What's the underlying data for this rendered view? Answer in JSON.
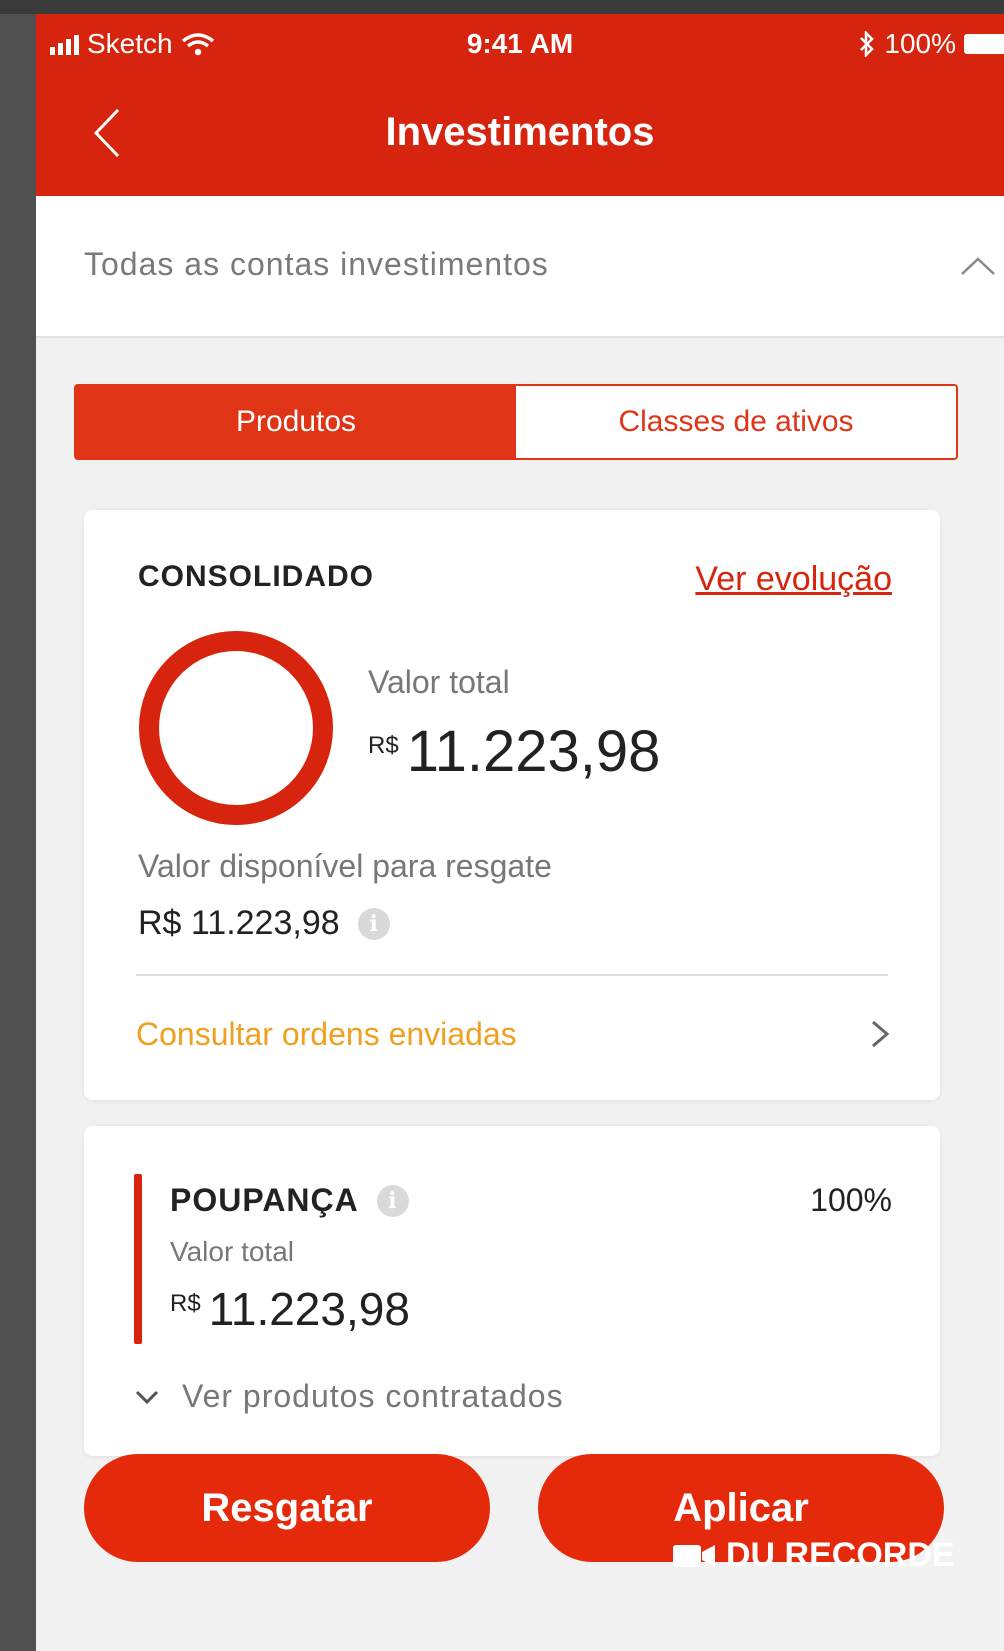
{
  "status_bar": {
    "carrier": "Sketch",
    "time": "9:41 AM",
    "battery": "100%"
  },
  "header": {
    "title": "Investimentos"
  },
  "account_selector": {
    "label": "Todas as contas investimentos"
  },
  "tabs": [
    {
      "label": "Produtos",
      "active": true
    },
    {
      "label": "Classes de ativos",
      "active": false
    }
  ],
  "consolidated_card": {
    "heading": "CONSOLIDADO",
    "evolution_link": "Ver evolução",
    "total_label": "Valor total",
    "currency": "R$",
    "total_value": "11.223,98",
    "available_label": "Valor disponível para resgate",
    "available_value": "R$ 11.223,98",
    "orders_link": "Consultar ordens enviadas",
    "donut_share": 1.0
  },
  "savings_card": {
    "title": "POUPANÇA",
    "percent": "100%",
    "total_label": "Valor total",
    "currency": "R$",
    "total_value": "11.223,98",
    "products_link": "Ver produtos contratados"
  },
  "actions": {
    "redeem": "Resgatar",
    "apply": "Aplicar"
  },
  "watermark": {
    "text": "DU RECORDE"
  },
  "colors": {
    "brand_red": "#d6240e",
    "link_orange": "#f0a020"
  }
}
